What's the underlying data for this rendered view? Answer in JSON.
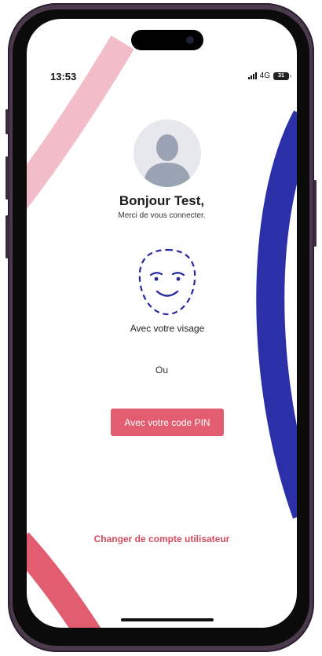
{
  "status_bar": {
    "time": "13:53",
    "network": "4G",
    "battery": "31"
  },
  "login": {
    "greeting": "Bonjour Test,",
    "subtitle": "Merci de vous connecter.",
    "face_label": "Avec votre visage",
    "or_text": "Ou",
    "pin_button": "Avec votre code PIN",
    "switch_account": "Changer de compte utilisateur"
  },
  "colors": {
    "accent": "#e35d70",
    "link": "#d44b5e",
    "pink_arc": "#f2bcc8",
    "blue_arc": "#2b2fa8",
    "face_icon": "#262a9c"
  },
  "icons": {
    "avatar": "user-silhouette-icon",
    "face": "face-id-icon"
  }
}
